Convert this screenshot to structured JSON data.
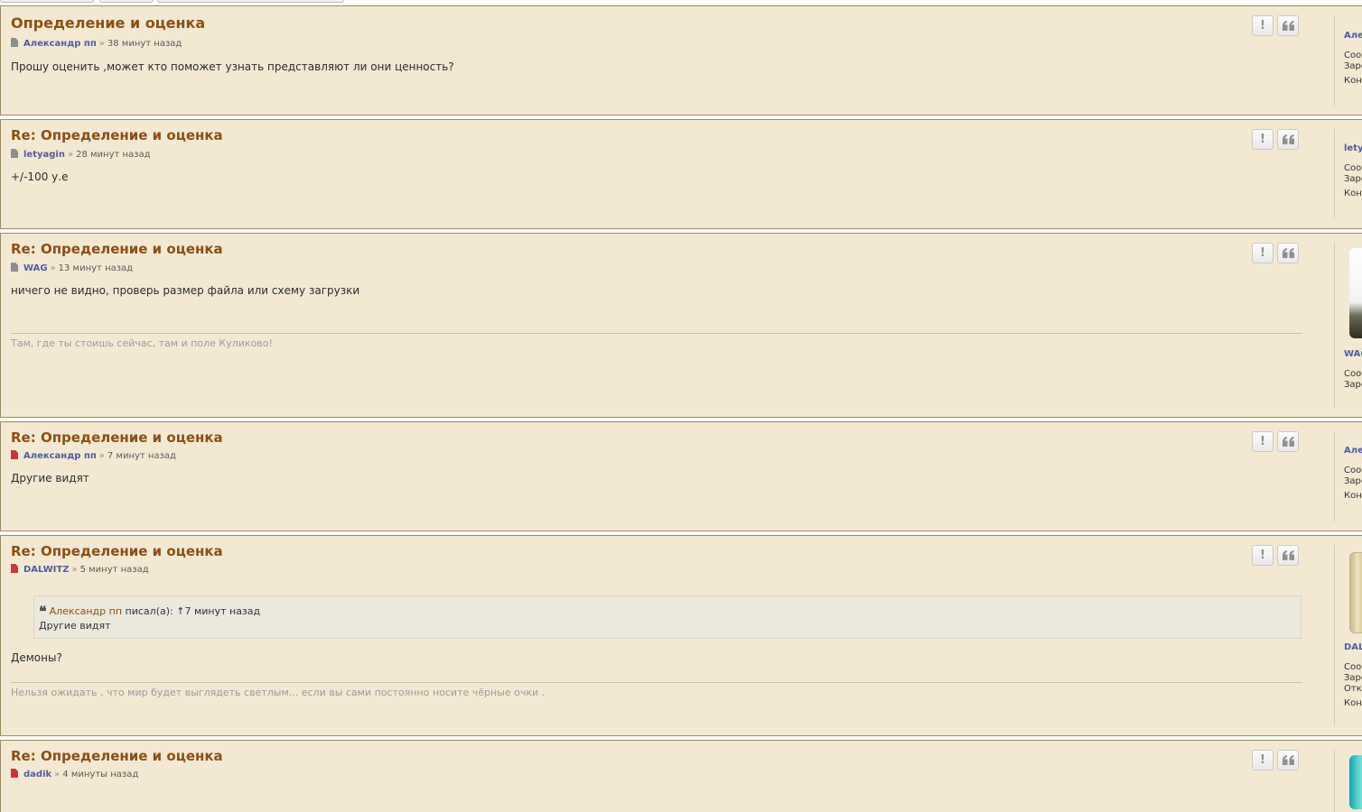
{
  "posts": [
    {
      "title": "Определение и оценка",
      "author": "Александр пп",
      "time": "38 минут назад",
      "sep": "»",
      "content": "Прошу оценить ,может кто поможет узнать представляют ли они ценность?",
      "profile": {
        "name": "Але",
        "lines": [
          "Сооб",
          "Заре",
          "Конт"
        ]
      }
    },
    {
      "title": "Re: Определение и оценка",
      "author": "letyagin",
      "time": "28 минут назад",
      "sep": "»",
      "content": "+/-100 у.е",
      "profile": {
        "name": "lety",
        "lines": [
          "Сооб",
          "Заре",
          "Конт"
        ]
      }
    },
    {
      "title": "Re: Определение и оценка",
      "author": "WAG",
      "time": "13 минут назад",
      "sep": "»",
      "content": "ничего не видно, проверь размер файла или схему загрузки",
      "signature": "Там, где ты стоишь сейчас, там и поле Куликово!",
      "profile": {
        "name": "WAG",
        "lines": [
          "Сооб",
          "Заре"
        ]
      }
    },
    {
      "title": "Re: Определение и оценка",
      "author": "Александр пп",
      "time": "7 минут назад",
      "sep": "»",
      "content": "Другие видят",
      "profile": {
        "name": "Але",
        "lines": [
          "Сооб",
          "Заре",
          "Конт"
        ]
      }
    },
    {
      "title": "Re: Определение и оценка",
      "author": "DALWITZ",
      "time": "5 минут назад",
      "sep": "»",
      "quote": {
        "author": "Александр пп",
        "wrote": "писал(а):",
        "arrow": "↑",
        "time": "7 минут назад",
        "body": "Другие видят"
      },
      "content": "Демоны?",
      "signature": "Нельзя ожидать , что мир будет выглядеть светлым... если вы сами постоянно носите чёрные очки .",
      "profile": {
        "name": "DAL",
        "lines": [
          "Сооб",
          "Заре",
          "Отку",
          "Конт"
        ]
      }
    },
    {
      "title": "Re: Определение и оценка",
      "author": "dadik",
      "time": "4 минуты назад",
      "sep": "»",
      "content": ""
    }
  ],
  "buttons": {
    "report": "!",
    "quote_icon": "quote-icon",
    "report_icon": "report-icon"
  },
  "colors": {
    "post_bg": "#f3e9d3",
    "title": "#8a4f16",
    "author": "#4f5d9c",
    "border": "#9d8a62"
  }
}
